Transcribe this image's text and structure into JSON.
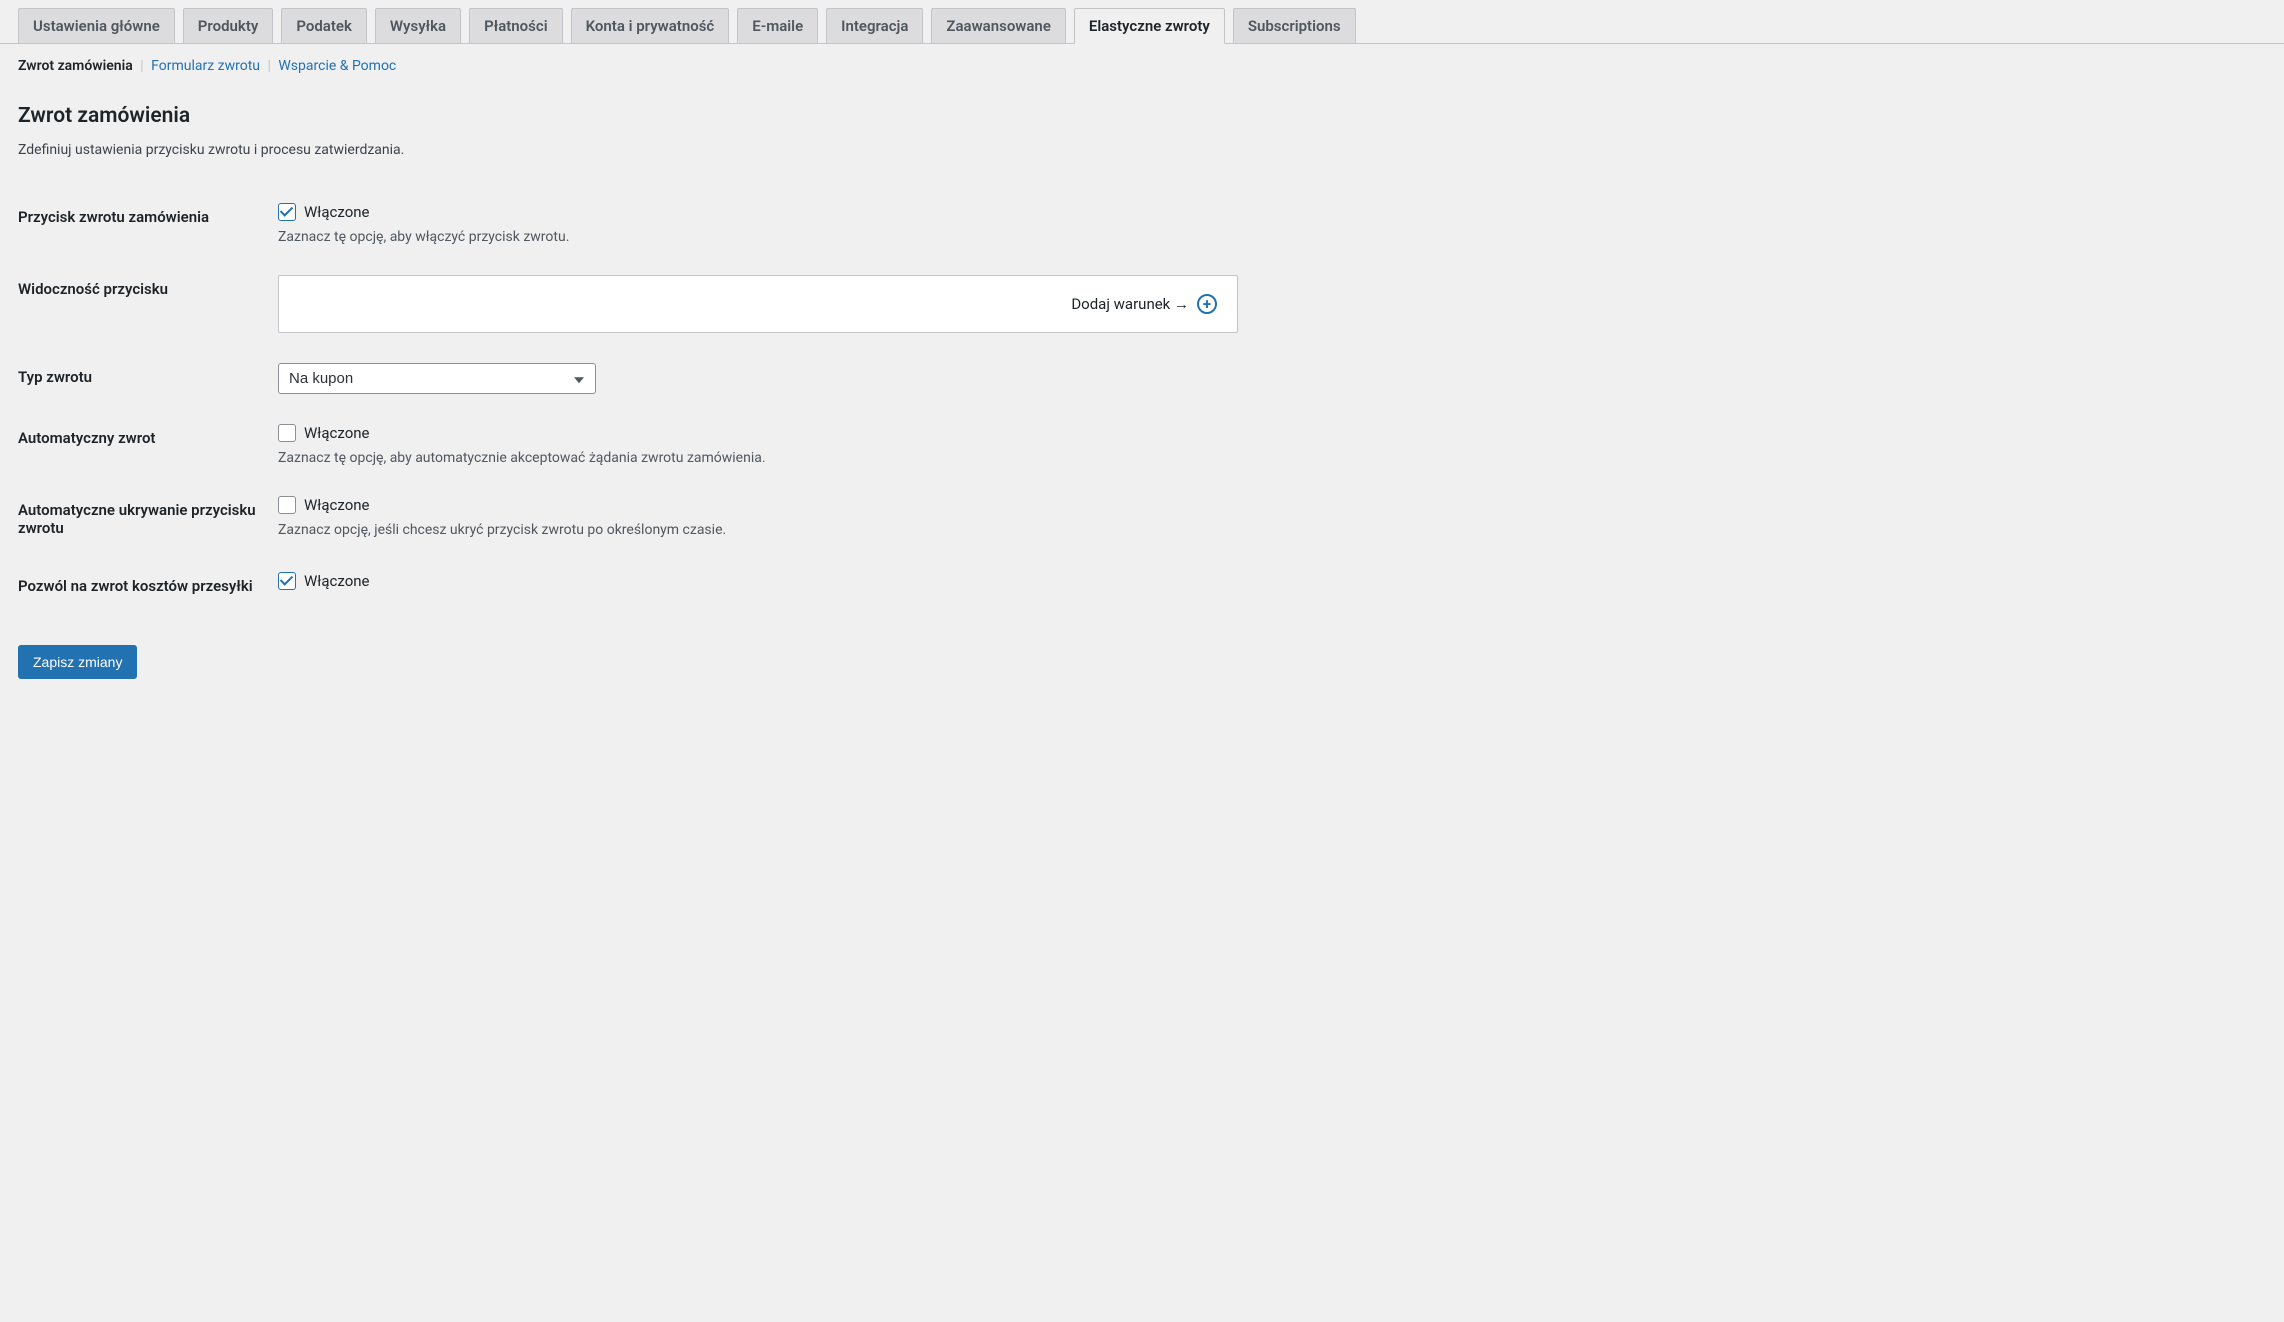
{
  "tabs": [
    {
      "label": "Ustawienia główne",
      "active": false
    },
    {
      "label": "Produkty",
      "active": false
    },
    {
      "label": "Podatek",
      "active": false
    },
    {
      "label": "Wysyłka",
      "active": false
    },
    {
      "label": "Płatności",
      "active": false
    },
    {
      "label": "Konta i prywatność",
      "active": false
    },
    {
      "label": "E-maile",
      "active": false
    },
    {
      "label": "Integracja",
      "active": false
    },
    {
      "label": "Zaawansowane",
      "active": false
    },
    {
      "label": "Elastyczne zwroty",
      "active": true
    },
    {
      "label": "Subscriptions",
      "active": false
    }
  ],
  "subnav": {
    "current": "Zwrot zamówienia",
    "link1": "Formularz zwrotu",
    "link2": "Wsparcie & Pomoc"
  },
  "section": {
    "title": "Zwrot zamówienia",
    "desc": "Zdefiniuj ustawienia przycisku zwrotu i procesu zatwierdzania."
  },
  "fields": {
    "refund_button": {
      "label": "Przycisk zwrotu zamówienia",
      "checkbox_label": "Włączone",
      "desc": "Zaznacz tę opcję, aby włączyć przycisk zwrotu."
    },
    "visibility": {
      "label": "Widoczność przycisku",
      "add_condition": "Dodaj warunek →"
    },
    "refund_type": {
      "label": "Typ zwrotu",
      "selected": "Na kupon"
    },
    "auto_refund": {
      "label": "Automatyczny zwrot",
      "checkbox_label": "Włączone",
      "desc": "Zaznacz tę opcję, aby automatycznie akceptować żądania zwrotu zamówienia."
    },
    "auto_hide": {
      "label": "Automatyczne ukrywanie przycisku zwrotu",
      "checkbox_label": "Włączone",
      "desc": "Zaznacz opcję, jeśli chcesz ukryć przycisk zwrotu po określonym czasie."
    },
    "allow_shipping": {
      "label": "Pozwól na zwrot kosztów przesyłki",
      "checkbox_label": "Włączone"
    }
  },
  "submit": {
    "label": "Zapisz zmiany"
  }
}
